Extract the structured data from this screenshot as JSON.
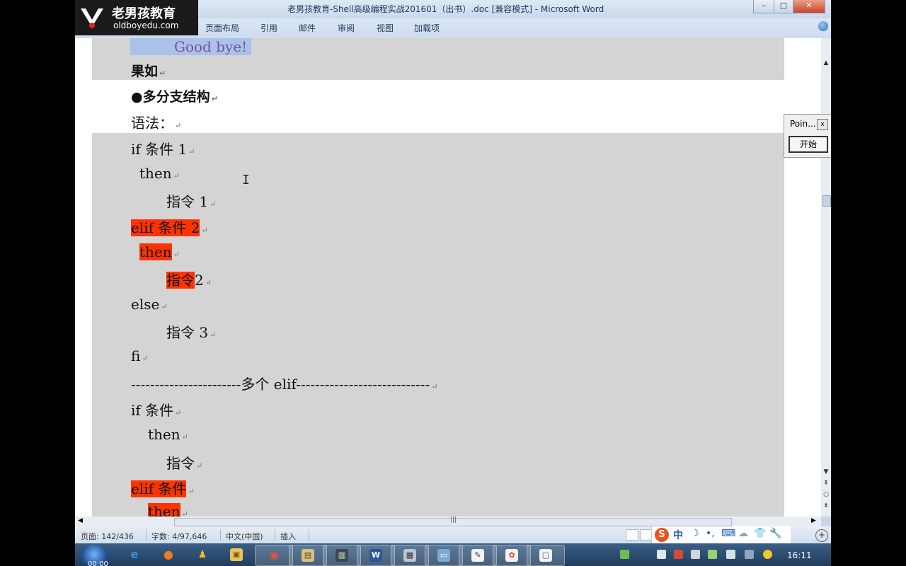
{
  "app": {
    "title": "老男孩教育-Shell高级编程实战201601（出书）.doc [兼容模式] - Microsoft Word",
    "logo_cn": "老男孩教育",
    "logo_en": "oldboyedu.com",
    "window_buttons": [
      "–",
      "□",
      "✕"
    ]
  },
  "ribbon": {
    "tabs": [
      "页面布局",
      "引用",
      "邮件",
      "审阅",
      "视图",
      "加载项"
    ]
  },
  "document": {
    "lines": [
      {
        "text": "Good bye!",
        "style": "selected"
      },
      {
        "text": "果如",
        "style": "bold"
      },
      {
        "text": "●多分支结构",
        "style": "bold"
      },
      {
        "text": "语法：",
        "style": "normal"
      },
      {
        "text": "if 条件 1",
        "style": "normal"
      },
      {
        "text": "then",
        "style": "normal"
      },
      {
        "text": "指令 1",
        "style": "normal"
      },
      {
        "text": "elif  条件 2",
        "style": "highlight"
      },
      {
        "text": "then",
        "style": "highlight"
      },
      {
        "text": "指令",
        "style": "highlight",
        "tail": "2"
      },
      {
        "text": "else",
        "style": "normal"
      },
      {
        "text": "指令 3",
        "style": "normal"
      },
      {
        "text": "fi",
        "style": "normal"
      },
      {
        "text": "-----------------------多个 elif----------------------------",
        "style": "normal"
      },
      {
        "text": "if 条件",
        "style": "normal"
      },
      {
        "text": "then",
        "style": "normal"
      },
      {
        "text": "指令",
        "style": "normal"
      },
      {
        "text": "elif  条件",
        "style": "highlight"
      },
      {
        "text": "then",
        "style": "highlight"
      }
    ],
    "paragraph_mark": "↵",
    "highlight_color": "#ff3300"
  },
  "pointofix": {
    "title": "Poin...",
    "close": "x",
    "start_label": "开始"
  },
  "status": {
    "page": "页面: 142/436",
    "words": "字数: 4/97,646",
    "language": "中文(中国)",
    "mode": "插入"
  },
  "ime": {
    "items": [
      "S",
      "中",
      "☽",
      "•,",
      "⌨",
      "☁",
      "👕",
      "🔧"
    ]
  },
  "taskbar": {
    "start_caption": "00:00",
    "apps": [
      {
        "icon": "ie-icon",
        "glyph": "e"
      },
      {
        "icon": "firefox-icon",
        "glyph": "●"
      },
      {
        "icon": "qq-icon",
        "glyph": "♟"
      },
      {
        "icon": "folder-icon",
        "glyph": "▣"
      },
      {
        "icon": "chrome-icon",
        "glyph": "◉"
      },
      {
        "icon": "explorer-icon",
        "glyph": "▤"
      },
      {
        "icon": "terminal-icon",
        "glyph": "▥"
      },
      {
        "icon": "word-icon",
        "glyph": "W"
      },
      {
        "icon": "calc-icon",
        "glyph": "▦"
      },
      {
        "icon": "screen-icon",
        "glyph": "▭"
      },
      {
        "icon": "notepad-icon",
        "glyph": "✎"
      },
      {
        "icon": "paint-icon",
        "glyph": "✿"
      },
      {
        "icon": "doc-icon",
        "glyph": "▢"
      }
    ],
    "clock": "16:11"
  }
}
